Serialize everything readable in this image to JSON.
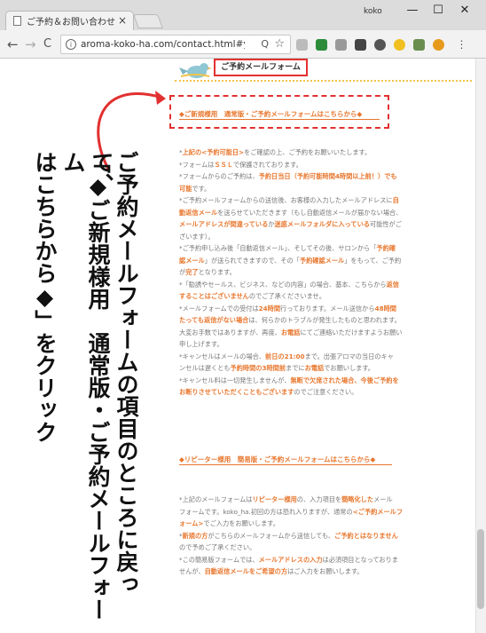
{
  "browser": {
    "tab_title": "ご予約＆お問い合わせ ア",
    "tab_close": "×",
    "user_name": "koko",
    "minimize": "—",
    "maximize": "☐",
    "close": "✕",
    "back": "←",
    "forward": "→",
    "reload": "C",
    "url": "aroma-koko-ha.com/contact.html#yoya...",
    "zoom_icon": "Q",
    "star_icon": "☆"
  },
  "page": {
    "header_label": "ご予約メールフォーム",
    "link_normal": "◆ご新規様用　通常版・ご予約メールフォームはこちらから◆",
    "link_repeater": "◆リピーター様用　簡易版・ご予約メールフォームはこちらから◆",
    "notes_block1": [
      [
        {
          "t": "*"
        },
        {
          "t": "上記の<予約可能日>",
          "h": true
        },
        {
          "t": "をご確認の上、ご予約をお願いいたします。"
        }
      ],
      [
        {
          "t": "*フォームは"
        },
        {
          "t": "ＳＳＬ",
          "h": true
        },
        {
          "t": "で保護されております。"
        }
      ],
      [
        {
          "t": "*フォームからのご予約は、"
        },
        {
          "t": "予約日当日（予約可能時間4時間以上前！）でも",
          "h": true
        }
      ],
      [
        {
          "t": "可能",
          "h": true
        },
        {
          "t": "です。"
        }
      ],
      [
        {
          "t": "*ご予約メールフォームからの送信後、お客様の入力したメールアドレスに"
        },
        {
          "t": "自",
          "h": true
        }
      ],
      [
        {
          "t": "動返信メール",
          "h": true
        },
        {
          "t": "を送らせていただきます（もし自動返信メールが届かない場合、"
        }
      ],
      [
        {
          "t": "メールアドレスが間違っている",
          "h": true
        },
        {
          "t": "か"
        },
        {
          "t": "迷惑メールフォルダに入っている",
          "h": true
        },
        {
          "t": "可能性がご"
        }
      ],
      [
        {
          "t": "ざいます）。"
        }
      ],
      [
        {
          "t": "*ご予約申し込み後「自動返信メール」、そしてその後、サロンから「"
        },
        {
          "t": "予約確",
          "h": true
        }
      ],
      [
        {
          "t": "認メール",
          "h": true
        },
        {
          "t": "」が送られてきますので、その「"
        },
        {
          "t": "予約確認メール",
          "h": true
        },
        {
          "t": "」をもって、ご予約"
        }
      ],
      [
        {
          "t": "が"
        },
        {
          "t": "完了",
          "h": true
        },
        {
          "t": "となります。"
        }
      ],
      [
        {
          "t": "*「勧誘やセールス、ビジネス、などの内容」の場合、基本、こちらから"
        },
        {
          "t": "返信",
          "h": true
        }
      ],
      [
        {
          "t": "することはございません",
          "h": true
        },
        {
          "t": "のでご了承くださいませ。"
        }
      ],
      [
        {
          "t": "*メールフォームでの受付は"
        },
        {
          "t": "24時間",
          "h": true
        },
        {
          "t": "行っております。メール送信から"
        },
        {
          "t": "48時間",
          "h": true
        }
      ],
      [
        {
          "t": "たっても返信がない場合",
          "h": true
        },
        {
          "t": "は、何らかのトラブルが発生したものと思われます。"
        }
      ],
      [
        {
          "t": "大変お手数ではありますが、再度、"
        },
        {
          "t": "お電話",
          "h": true
        },
        {
          "t": "にてご連絡いただけますようお願い"
        }
      ],
      [
        {
          "t": "申し上げます。"
        }
      ],
      [
        {
          "t": "*キャンセルはメールの場合、"
        },
        {
          "t": "前日の21:00",
          "h": true
        },
        {
          "t": "まで。出張アロマの当日のキャ"
        }
      ],
      [
        {
          "t": "ンセルは遅くとも"
        },
        {
          "t": "予約時間の3時間前",
          "h": true
        },
        {
          "t": "までに"
        },
        {
          "t": "お電話",
          "h": true
        },
        {
          "t": "でお願いします。"
        }
      ],
      [
        {
          "t": "*キャンセル料は一切発生しませんが、"
        },
        {
          "t": "無断で欠席された場合、今後ご予約を",
          "h": true
        }
      ],
      [
        {
          "t": "お断りさせていただくこともございます",
          "h": true
        },
        {
          "t": "のでご注意ください。"
        }
      ]
    ],
    "notes_block2": [
      [
        {
          "t": "*上記のメールフォームは"
        },
        {
          "t": "リピーター様用",
          "h": true
        },
        {
          "t": "の、入力項目を"
        },
        {
          "t": "簡略化した",
          "h": true
        },
        {
          "t": "メール"
        }
      ],
      [
        {
          "t": "フォームです。koko_ha.初回の方は恐れ入りますが、通常の"
        },
        {
          "t": "<ご予約メールフ",
          "h": true
        }
      ],
      [
        {
          "t": "ォーム>",
          "h": true
        },
        {
          "t": "でご入力をお願いします。"
        }
      ],
      [
        {
          "t": "*"
        },
        {
          "t": "新規の方",
          "h": true
        },
        {
          "t": "がこちらのメールフォームから送信しても、"
        },
        {
          "t": "ご予約とはなりません",
          "h": true
        }
      ],
      [
        {
          "t": "ので予めご了承ください。"
        }
      ],
      [
        {
          "t": "*この簡易版フォームでは、"
        },
        {
          "t": "メールアドレスの入力",
          "h": true
        },
        {
          "t": "は必須項目となっておりま"
        }
      ],
      [
        {
          "t": "せんが、"
        },
        {
          "t": "自動返信メールをご希望の方",
          "h": true
        },
        {
          "t": "はご入力をお願いします。"
        }
      ]
    ]
  },
  "annotation": {
    "col1": "ご予約メールフォームの項目のところに戻って、",
    "col2": "「◆ご新規様用　通常版・ご予約メールフォーム",
    "col3": "はこちらから◆」をクリック"
  },
  "colors": {
    "highlight": "#e8772e",
    "red_box": "#e23030",
    "text_gray": "#777777"
  }
}
